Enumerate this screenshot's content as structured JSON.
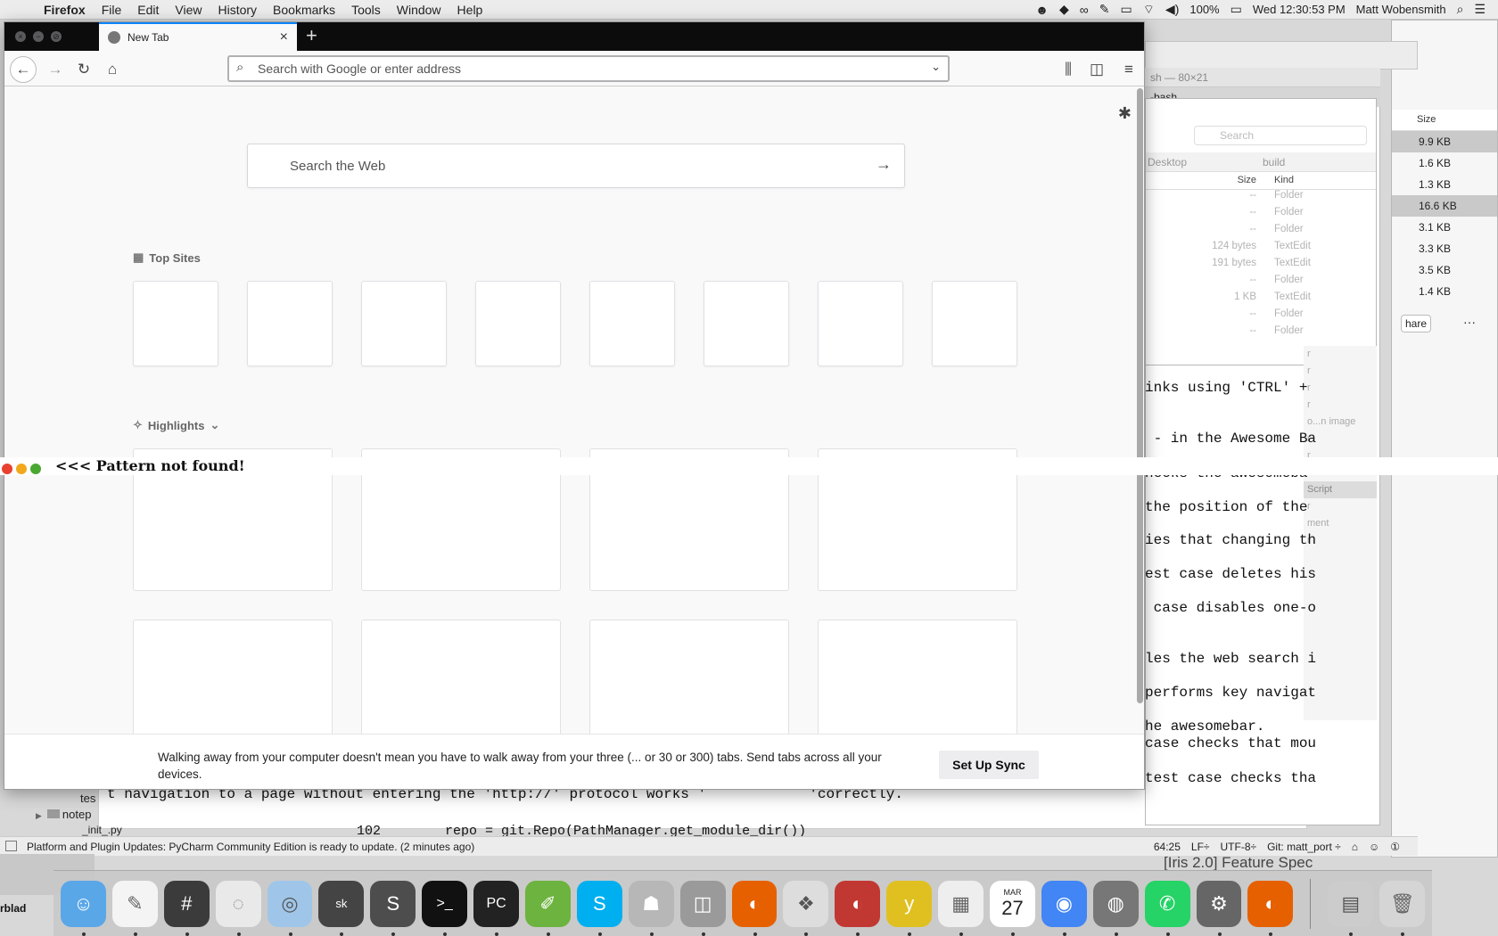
{
  "menubar": {
    "app_name": "Firefox",
    "menus": [
      "File",
      "Edit",
      "View",
      "History",
      "Bookmarks",
      "Tools",
      "Window",
      "Help"
    ],
    "battery": "100%",
    "clock": "Wed 12:30:53 PM",
    "user": "Matt Wobensmith"
  },
  "firefox": {
    "tab_title": "New Tab",
    "url_placeholder": "Search with Google or enter address",
    "web_search_placeholder": "Search the Web",
    "top_sites_title": "Top Sites",
    "highlights_title": "Highlights",
    "sync_message": "Walking away from your computer doesn't mean you have to walk away from your three (... or 30 or 300) tabs. Send tabs across all your devices.",
    "sync_button": "Set Up Sync"
  },
  "pattern_overlay": {
    "text": "<<< Pattern not found!",
    "dot_colors": [
      "#e8412f",
      "#f2a81d",
      "#4aa832"
    ]
  },
  "terminal": {
    "title": "sh — 80×21",
    "tab": "-bash"
  },
  "finder_mid": {
    "search_placeholder": "Search",
    "tabs": [
      "Desktop",
      "build"
    ],
    "col_size": "Size",
    "col_kind": "Kind",
    "rows": [
      {
        "size": "--",
        "kind": "Folder"
      },
      {
        "size": "--",
        "kind": "Folder"
      },
      {
        "size": "--",
        "kind": "Folder"
      },
      {
        "size": "124 bytes",
        "kind": "TextEdit"
      },
      {
        "size": "191 bytes",
        "kind": "TextEdit"
      },
      {
        "size": "--",
        "kind": "Folder"
      },
      {
        "size": "1 KB",
        "kind": "TextEdit"
      },
      {
        "size": "--",
        "kind": "Folder"
      },
      {
        "size": "--",
        "kind": "Folder"
      }
    ]
  },
  "finder_right": {
    "col_size": "Size",
    "sizes": [
      "9.9 KB",
      "1.6 KB",
      "1.3 KB",
      "16.6 KB",
      "3.1 KB",
      "3.3 KB",
      "3.5 KB",
      "1.4 KB"
    ],
    "share": "hare"
  },
  "side_kinds": [
    "r",
    "r",
    "r",
    "r",
    "o...n image",
    "r",
    "r",
    "r",
    "Script",
    "r",
    "ment",
    "r"
  ],
  "code_lines": [
    "inks using 'CTRL' +",
    " - in the Awesome Ba",
    "hecks the awesomeba",
    "the position of the",
    "ies that changing th",
    "est case deletes his",
    " case disables one-o",
    "les the web search i",
    "performs key navigat",
    "he awesomebar.",
    "case checks that mou",
    "test case checks tha"
  ],
  "code_bottom": "t navigation to a page without entering the 'http://' protocol works '            'correctly.",
  "code_bottom2": "102        repo = git.Repo(PathManager.get_module_dir())",
  "tree": {
    "item1": "notep",
    "item2": "tes",
    "item3": "_init_.py"
  },
  "statusbar": {
    "message": "Platform and Plugin Updates: PyCharm Community Edition is ready to update. (2 minutes ago)",
    "position": "64:25",
    "line_sep": "LF÷",
    "encoding": "UTF-8÷",
    "git": "Git: matt_port ÷"
  },
  "feature_spec": "[Iris 2.0] Feature Spec",
  "desktop_label": "rblad",
  "dock_calendar": {
    "month": "MAR",
    "day": "27"
  }
}
